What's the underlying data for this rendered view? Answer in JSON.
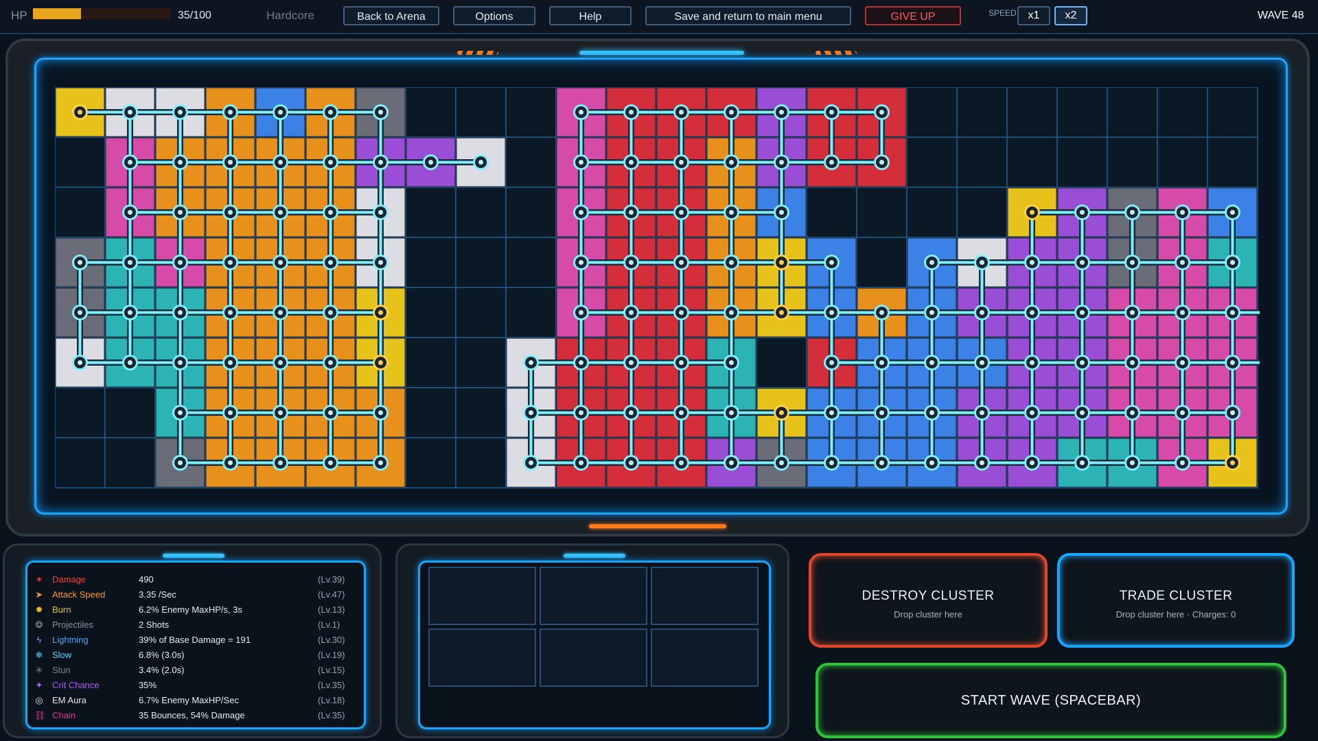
{
  "hud": {
    "hp_label": "HP",
    "hp_text": "35/100",
    "hp_fraction": 0.35,
    "difficulty": "Hardcore",
    "buttons": {
      "back": "Back to Arena",
      "options": "Options",
      "help": "Help",
      "save": "Save and return to main menu",
      "giveup": "GIVE UP"
    },
    "speed_label": "SPEED",
    "speed_x1": "x1",
    "speed_x2": "x2",
    "speed_selected": "x2",
    "wave": "WAVE 48"
  },
  "colors": {
    "yellow": "#e6c21a",
    "white": "#dcdde3",
    "orange": "#e8901c",
    "blue": "#3c82e6",
    "gray": "#6a6d78",
    "magenta": "#d64aa8",
    "purple": "#9a4ed6",
    "teal": "#2cb4b4",
    "red": "#d42e3a",
    "grid_line": "#1f5a88",
    "connector": "#7ef0ff"
  },
  "board": {
    "cols": 24,
    "rows": 8,
    "grid": [
      "YWWOBOG...MRRRPRR.......",
      ".MOOOOPPW.MRROPRR.......",
      ".MOOOOW...MRROB....YPGMB",
      "GTMOOOW...MRROYB.BWPPGMT",
      "GTTOOOY...MRROYBOBPPPMMMT",
      "WTTOOOY..WRRRT.RBBBPPMMMG",
      "..TOOOO..WRRRTYBBBPPPMMM",
      "..GOOOO..WRRRPGBBBPPTTMY"
    ]
  },
  "stats": [
    {
      "icon": "damage-icon",
      "glyph": "✶",
      "name": "Damage",
      "value": "490",
      "level": "(Lv.39)",
      "color": "#ff3b3b"
    },
    {
      "icon": "attack-speed-icon",
      "glyph": "➤",
      "name": "Attack Speed",
      "value": "3.35 /Sec",
      "level": "(Lv.47)",
      "color": "#ff9a2a"
    },
    {
      "icon": "burn-icon",
      "glyph": "✹",
      "name": "Burn",
      "value": "6.2% Enemy MaxHP/s, 3s",
      "level": "(Lv.13)",
      "color": "#f0c419"
    },
    {
      "icon": "projectiles-icon",
      "glyph": "❂",
      "name": "Projectiles",
      "value": "2 Shots",
      "level": "(Lv.1)",
      "color": "#8a93a0"
    },
    {
      "icon": "lightning-icon",
      "glyph": "ϟ",
      "name": "Lightning",
      "value": "39% of Base Damage = 191",
      "level": "(Lv.30)",
      "color": "#4ea6ff"
    },
    {
      "icon": "slow-icon",
      "glyph": "❄",
      "name": "Slow",
      "value": "6.8% (3.0s)",
      "level": "(Lv.19)",
      "color": "#4fd6ff"
    },
    {
      "icon": "stun-icon",
      "glyph": "✳",
      "name": "Stun",
      "value": "3.4% (2.0s)",
      "level": "(Lv.15)",
      "color": "#7e8690"
    },
    {
      "icon": "crit-chance-icon",
      "glyph": "✦",
      "name": "Crit Chance",
      "value": "35%",
      "level": "(Lv.35)",
      "color": "#b45cff"
    },
    {
      "icon": "em-aura-icon",
      "glyph": "◎",
      "name": "EM Aura",
      "value": "6.7% Enemy MaxHP/Sec",
      "level": "(Lv.18)",
      "color": "#e6e6e6"
    },
    {
      "icon": "chain-icon",
      "glyph": "⛓",
      "name": "Chain",
      "value": "35 Bounces, 54% Damage",
      "level": "(Lv.35)",
      "color": "#e0359a"
    }
  ],
  "actions": {
    "destroy_title": "DESTROY CLUSTER",
    "destroy_sub": "Drop cluster here",
    "trade_title": "TRADE CLUSTER",
    "trade_sub": "Drop cluster here  ·  Charges: 0",
    "start_wave": "START WAVE   (SPACEBAR)"
  }
}
